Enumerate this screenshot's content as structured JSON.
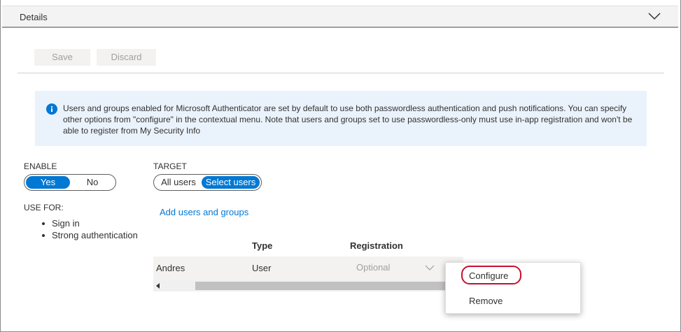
{
  "details": {
    "title": "Details",
    "collapse_icon": "chevron-down-icon"
  },
  "toolbar": {
    "save_label": "Save",
    "discard_label": "Discard"
  },
  "info": {
    "icon": "info-icon",
    "message": "Users and groups enabled for Microsoft Authenticator are set by default to use both passwordless authentication and push notifications. You can specify other options from \"configure\" in the contextual menu. Note that users and groups set to use passwordless-only must use in-app registration and won't be able to register from My Security Info"
  },
  "enable": {
    "label": "ENABLE",
    "options": [
      "Yes",
      "No"
    ],
    "selected": "Yes"
  },
  "target": {
    "label": "TARGET",
    "options": [
      "All users",
      "Select users"
    ],
    "selected": "Select users"
  },
  "use_for": {
    "label": "USE FOR:",
    "items": [
      "Sign in",
      "Strong authentication"
    ]
  },
  "add_link": "Add users and groups",
  "table": {
    "columns": [
      "",
      "Type",
      "Registration"
    ],
    "rows": [
      {
        "name": "Andres",
        "type": "User",
        "registration": "Optional"
      }
    ]
  },
  "context_menu": {
    "items": [
      "Configure",
      "Remove"
    ],
    "highlighted": "Configure"
  },
  "colors": {
    "accent": "#0078d4",
    "info_bg": "#eaf3fc",
    "highlight": "#c8102e"
  }
}
